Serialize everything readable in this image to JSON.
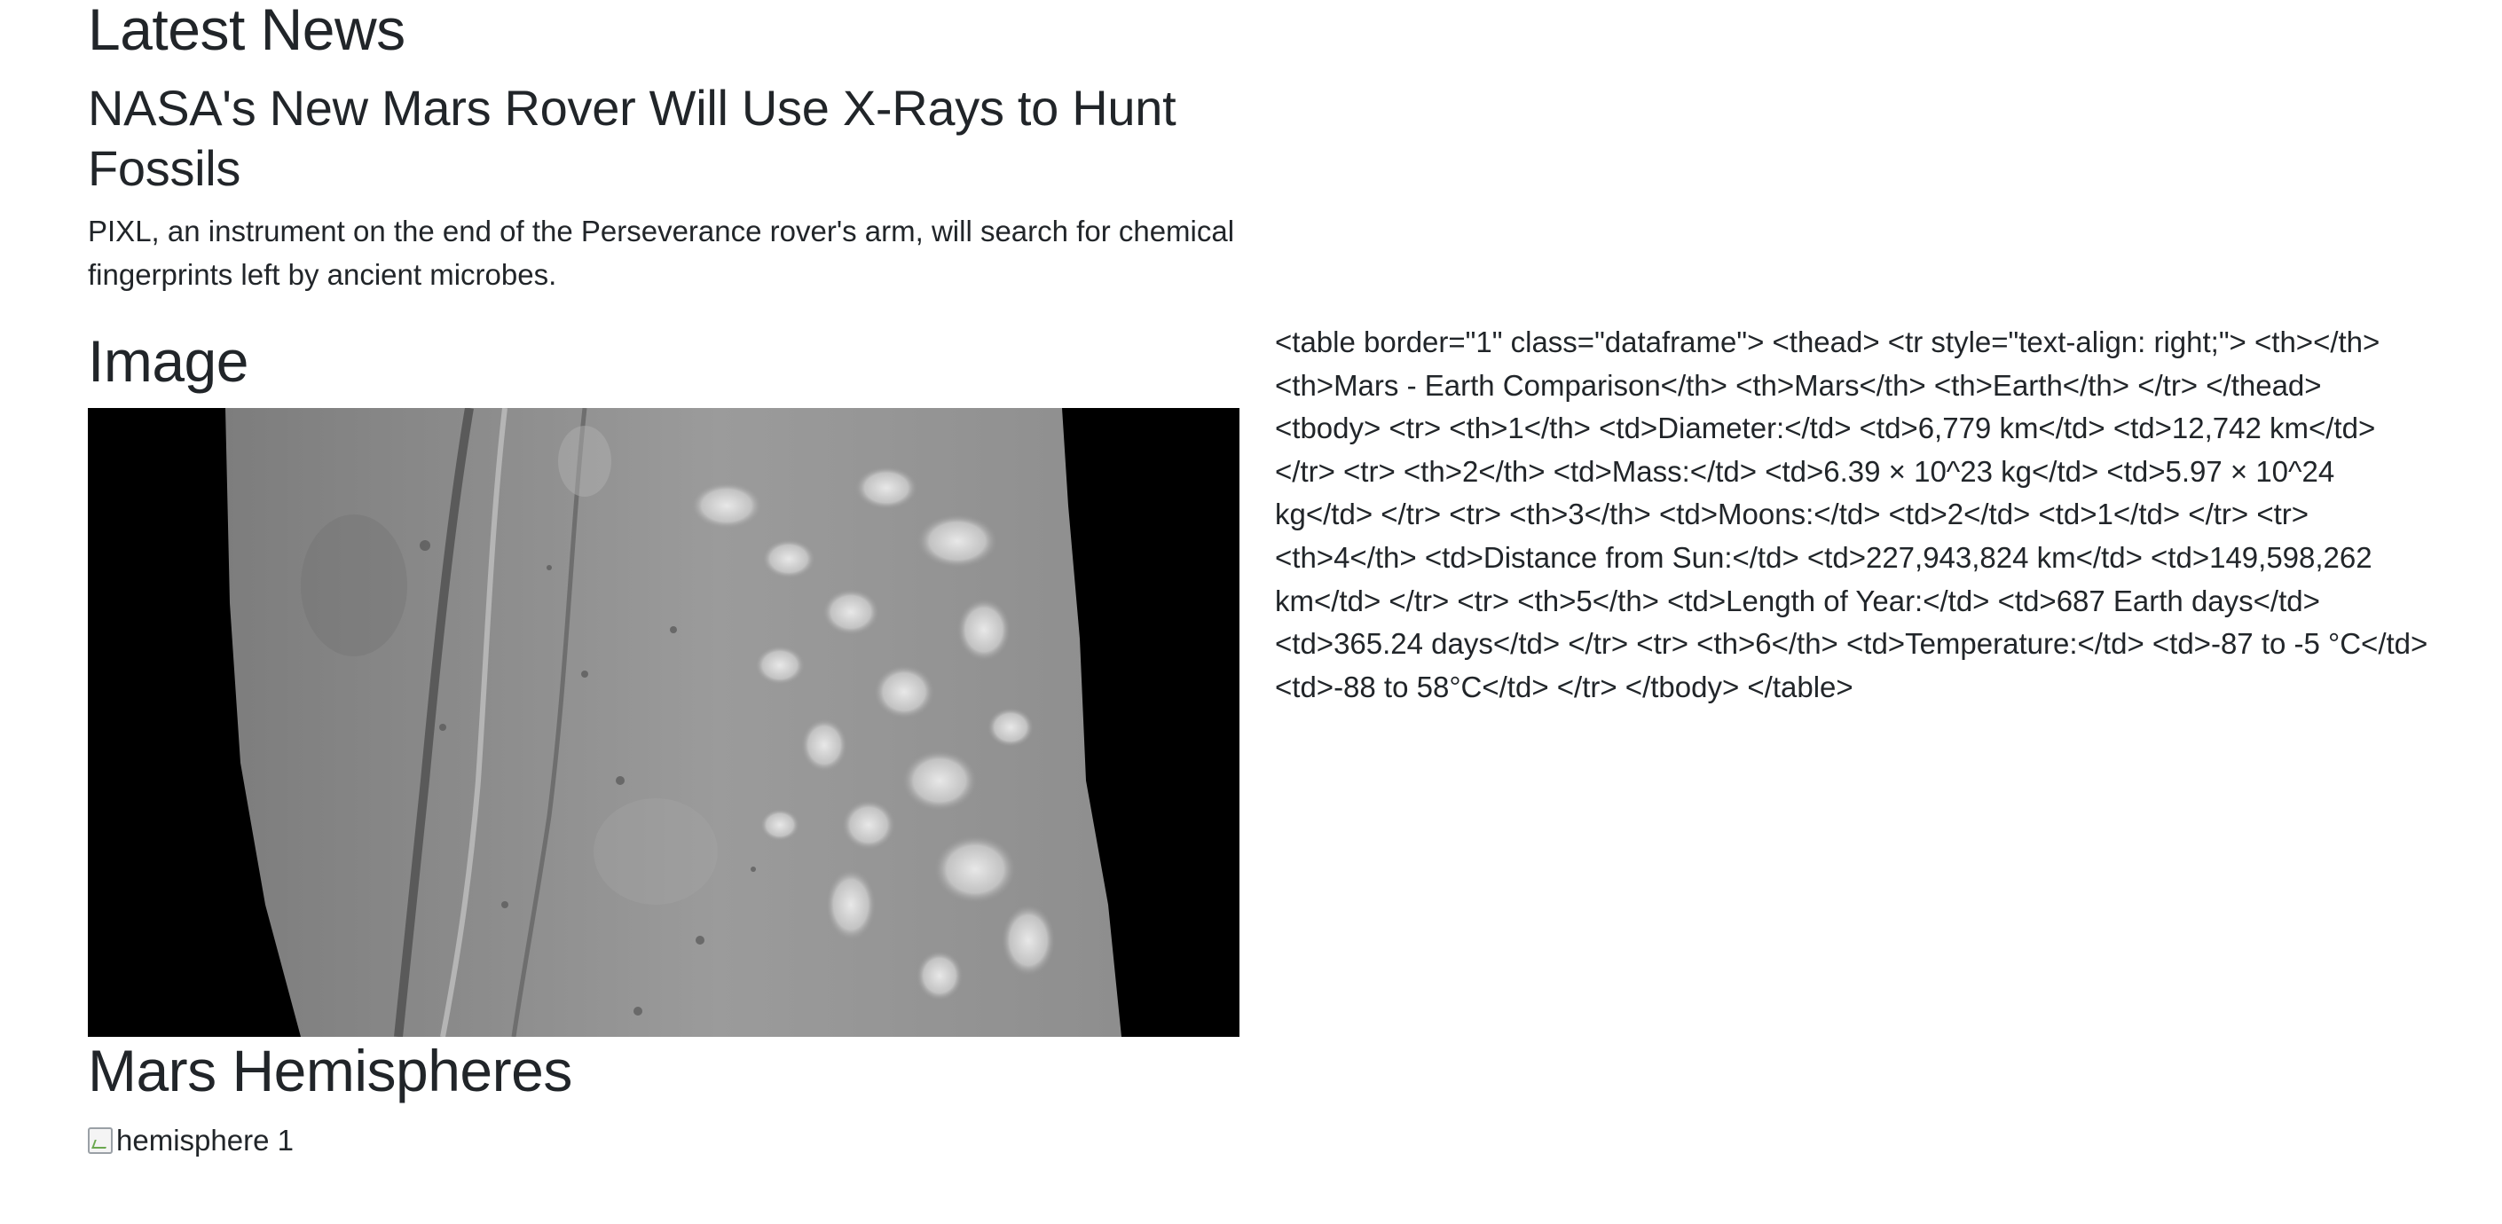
{
  "news": {
    "section_title": "Latest News",
    "headline": "NASA's New Mars Rover Will Use X-Rays to Hunt Fossils",
    "teaser": "PIXL, an instrument on the end of the Perseverance rover's arm, will search for chemical fingerprints left by ancient microbes."
  },
  "featured": {
    "section_title": "Image"
  },
  "hemispheres": {
    "section_title": "Mars Hemispheres",
    "images": [
      {
        "alt": "hemisphere 1"
      }
    ]
  },
  "facts": {
    "raw_html_text": "<table border=\"1\" class=\"dataframe\"> <thead> <tr style=\"text-align: right;\"> <th></th> <th>Mars - Earth Comparison</th> <th>Mars</th> <th>Earth</th> </tr> </thead> <tbody> <tr> <th>1</th> <td>Diameter:</td> <td>6,779 km</td> <td>12,742 km</td> </tr> <tr> <th>2</th> <td>Mass:</td> <td>6.39 × 10^23 kg</td> <td>5.97 × 10^24 kg</td> </tr> <tr> <th>3</th> <td>Moons:</td> <td>2</td> <td>1</td> </tr> <tr> <th>4</th> <td>Distance from Sun:</td> <td>227,943,824 km</td> <td>149,598,262 km</td> </tr> <tr> <th>5</th> <td>Length of Year:</td> <td>687 Earth days</td> <td>365.24 days</td> </tr> <tr> <th>6</th> <td>Temperature:</td> <td>-87 to -5 °C</td> <td>-88 to 58°C</td> </tr> </tbody> </table>"
  }
}
